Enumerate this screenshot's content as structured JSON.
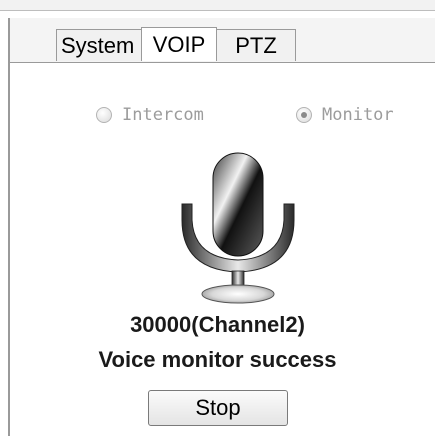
{
  "tabs": [
    {
      "label": "System",
      "active": false
    },
    {
      "label": "VOIP",
      "active": true
    },
    {
      "label": "PTZ",
      "active": false
    }
  ],
  "mode_options": [
    {
      "label": "Intercom",
      "checked": false,
      "enabled": false
    },
    {
      "label": "Monitor",
      "checked": true,
      "enabled": false
    }
  ],
  "icon": "microphone-icon",
  "status": {
    "channel": "30000(Channel2)",
    "message": "Voice monitor success"
  },
  "stop_button": {
    "label": "Stop"
  }
}
